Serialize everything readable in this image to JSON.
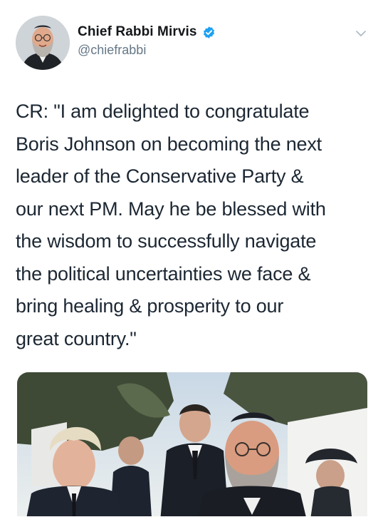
{
  "author": {
    "display_name": "Chief Rabbi Mirvis",
    "handle": "@chiefrabbi",
    "verified": true,
    "avatar_icon": "avatar-photo"
  },
  "tweet": {
    "lines": [
      "CR: \"I am delighted to congratulate",
      "Boris Johnson on becoming the next",
      "leader of the Conservative Party &",
      "our next PM. May he be blessed with",
      "the wisdom to successfully navigate",
      "the political uncertainties we face &",
      "bring healing & prosperity to our",
      "great country.\""
    ]
  },
  "media": {
    "type": "photo",
    "icon": "photo-image"
  },
  "colors": {
    "verified_blue": "#1da1f2",
    "text": "#1c2733",
    "secondary": "#657786"
  },
  "icons": {
    "menu": "chevron-down-icon",
    "verified": "verified-badge-icon"
  }
}
